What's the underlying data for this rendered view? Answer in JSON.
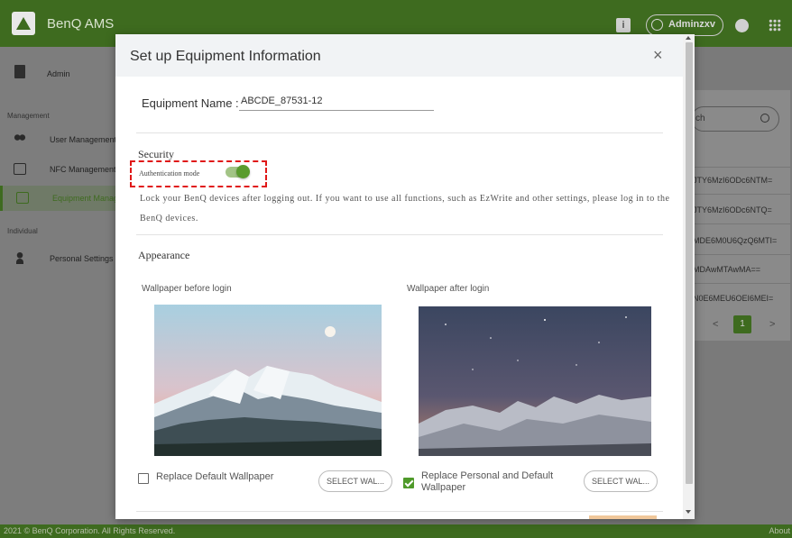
{
  "app": {
    "title": "BenQ AMS",
    "user_label": "Adminzxv",
    "icons": [
      "logo-icon",
      "info-icon",
      "user-icon",
      "globe-icon",
      "apps-grid-icon"
    ]
  },
  "sidebar": {
    "admin_label": "Admin",
    "management_section": "Management",
    "individual_section": "Individual",
    "items": [
      {
        "label": "User Management",
        "icon": "users-icon"
      },
      {
        "label": "NFC Management",
        "icon": "nfc-icon"
      },
      {
        "label": "Equipment Manag",
        "icon": "monitor-icon",
        "active": true
      },
      {
        "label": "Personal Settings",
        "icon": "person-icon"
      }
    ]
  },
  "background_table": {
    "search_placeholder": "ch",
    "rows": [
      "JTY6MzI6ODc6NTM=",
      "JTY6MzI6ODc6NTQ=",
      "MDE6M0U6QzQ6MTI=",
      "MDAwMTAwMA==",
      "N0E6MEU6OEI6MEI="
    ],
    "pagination": {
      "prev": "<",
      "current": "1",
      "next": ">"
    }
  },
  "footer": {
    "copyright": "2021 © BenQ Corporation. All Rights Reserved.",
    "about": "About"
  },
  "modal": {
    "title": "Set up Equipment Information",
    "close_glyph": "×",
    "equipment_name_label": "Equipment Name :",
    "equipment_name_value": "ABCDE_87531-12",
    "security": {
      "title": "Security",
      "auth_mode_label": "Authentication mode",
      "auth_mode_enabled": true,
      "description": "Lock your BenQ devices after logging out. If you want to use all functions, such as EzWrite and other settings, please log in to the BenQ devices."
    },
    "appearance": {
      "title": "Appearance",
      "before_login": {
        "label": "Wallpaper before login",
        "checkbox_label": "Replace Default Wallpaper",
        "checked": false,
        "button_label": "SELECT WAL..."
      },
      "after_login": {
        "label": "Wallpaper after login",
        "checkbox_label": "Replace Personal and Default Wallpaper",
        "checked": true,
        "button_label": "SELECT WAL..."
      }
    }
  },
  "colors": {
    "brand_green": "#3e6b1f",
    "toggle_green": "#5a9b2e",
    "checkbox_green": "#4f9a2a",
    "highlight_red": "#e01818"
  }
}
